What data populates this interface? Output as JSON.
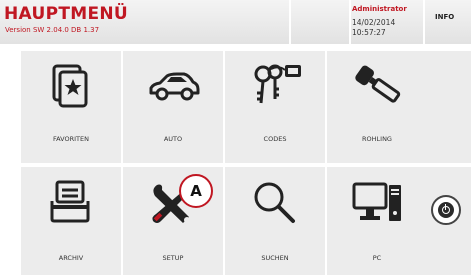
{
  "header": {
    "title": "HAUPTMENÜ",
    "version": "Version SW 2.04.0 DB 1.37",
    "user": "Administrator",
    "date": "14/02/2014",
    "time": "10:57:27",
    "info_label": "INFO"
  },
  "menu": {
    "tiles": [
      {
        "label": "FAVORITEN",
        "icon": "favorites-star-icon"
      },
      {
        "label": "AUTO",
        "icon": "car-icon"
      },
      {
        "label": "CODES",
        "icon": "keys-tag-icon"
      },
      {
        "label": "ROHLING",
        "icon": "key-blank-icon"
      },
      {
        "label": "ARCHIV",
        "icon": "archive-tray-icon"
      },
      {
        "label": "SETUP",
        "icon": "wrench-screwdriver-icon"
      },
      {
        "label": "SUCHEN",
        "icon": "magnifier-icon"
      },
      {
        "label": "PC",
        "icon": "computer-icon"
      }
    ]
  },
  "side": {
    "power_icon": "power-icon"
  },
  "callout": {
    "label": "A"
  },
  "colors": {
    "accent": "#c01722",
    "tile_bg": "#ececec",
    "header_bg": "#e6e6e6"
  }
}
